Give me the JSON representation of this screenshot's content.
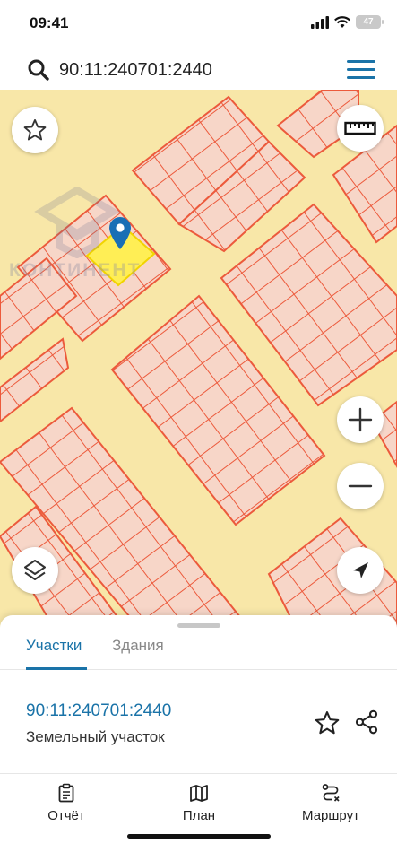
{
  "status_bar": {
    "time": "09:41",
    "battery": "47"
  },
  "search": {
    "value": "90:11:240701:2440"
  },
  "map": {
    "watermark_text": "КОНТИНЕНТ"
  },
  "sheet": {
    "tabs": [
      {
        "label": "Участки",
        "active": true
      },
      {
        "label": "Здания",
        "active": false
      }
    ],
    "parcel": {
      "cadastral_number": "90:11:240701:2440",
      "type": "Земельный участок"
    }
  },
  "bottom_nav": [
    {
      "label": "Отчёт",
      "icon": "clipboard-icon"
    },
    {
      "label": "План",
      "icon": "map-icon"
    },
    {
      "label": "Маршрут",
      "icon": "route-icon"
    }
  ],
  "colors": {
    "accent": "#1a73a8",
    "parcel_fill": "#f7d6c8",
    "parcel_border": "#ec5a3c",
    "road": "#f8e7a8",
    "selected": "#ffee55"
  }
}
